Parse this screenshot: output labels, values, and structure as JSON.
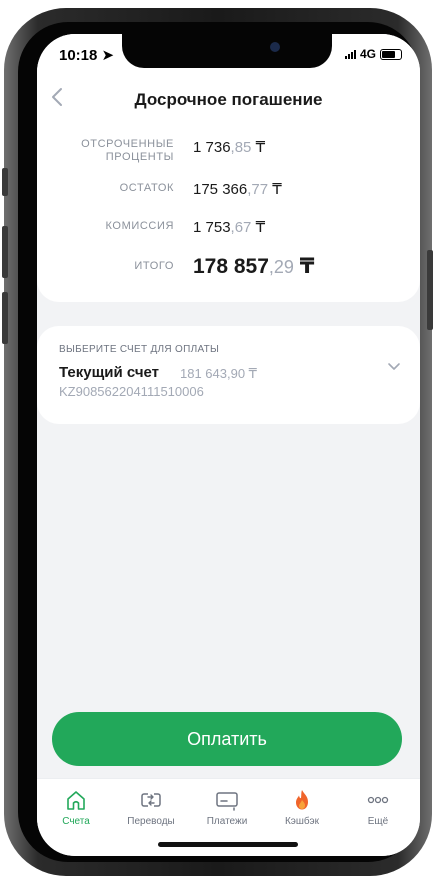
{
  "status_bar": {
    "time": "10:18",
    "network": "4G"
  },
  "header": {
    "title": "Досрочное погашение"
  },
  "summary": {
    "rows": [
      {
        "label_line1": "ОТСРОЧЕННЫЕ",
        "label_line2": "ПРОЦЕНТЫ",
        "value_int": "1 736",
        "value_dec": ",85",
        "currency": "₸"
      },
      {
        "label": "ОСТАТОК",
        "value_int": "175 366",
        "value_dec": ",77",
        "currency": "₸"
      },
      {
        "label": "КОМИССИЯ",
        "value_int": "1 753",
        "value_dec": ",67",
        "currency": "₸"
      },
      {
        "label": "ИТОГО",
        "value_int": "178 857",
        "value_dec": ",29",
        "currency": "₸"
      }
    ]
  },
  "account": {
    "section_title": "ВЫБЕРИТЕ СЧЕТ ДЛЯ ОПЛАТЫ",
    "name": "Текущий счет",
    "balance": "181 643,90 ₸",
    "number": "KZ908562204111510006"
  },
  "pay_button": {
    "label": "Оплатить"
  },
  "tab_bar": {
    "tabs": [
      {
        "label": "Счета",
        "icon": "home-icon",
        "active": true
      },
      {
        "label": "Переводы",
        "icon": "transfer-icon",
        "active": false
      },
      {
        "label": "Платежи",
        "icon": "payments-icon",
        "active": false
      },
      {
        "label": "Кэшбэк",
        "icon": "cashback-flame-icon",
        "active": false
      },
      {
        "label": "Ещё",
        "icon": "more-icon",
        "active": false
      }
    ]
  },
  "colors": {
    "accent": "#22a85a",
    "background": "#f2f3f5",
    "muted": "#a3a9b5",
    "cashback": "#f0642a"
  }
}
